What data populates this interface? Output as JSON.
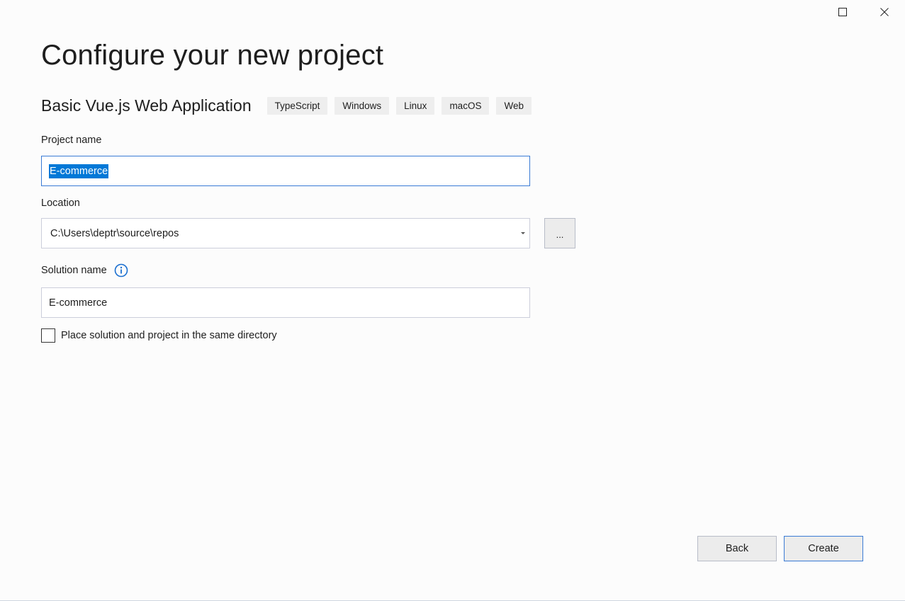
{
  "window": {
    "controls": {
      "maximize_icon": "maximize-icon",
      "close_icon": "close-icon"
    }
  },
  "page": {
    "title": "Configure your new project",
    "template_name": "Basic Vue.js Web Application",
    "tags": [
      "TypeScript",
      "Windows",
      "Linux",
      "macOS",
      "Web"
    ]
  },
  "form": {
    "project_name": {
      "label": "Project name",
      "value": "E-commerce"
    },
    "location": {
      "label": "Location",
      "value": "C:\\Users\\deptr\\source\\repos",
      "browse_label": "..."
    },
    "solution_name": {
      "label": "Solution name",
      "value": "E-commerce",
      "info_icon": "info-icon"
    },
    "same_directory": {
      "label": "Place solution and project in the same directory",
      "checked": false
    }
  },
  "actions": {
    "back_label": "Back",
    "create_label": "Create"
  },
  "colors": {
    "accent": "#0078d7",
    "focus_border": "#3a7bd5",
    "button_bg": "#ececec"
  }
}
